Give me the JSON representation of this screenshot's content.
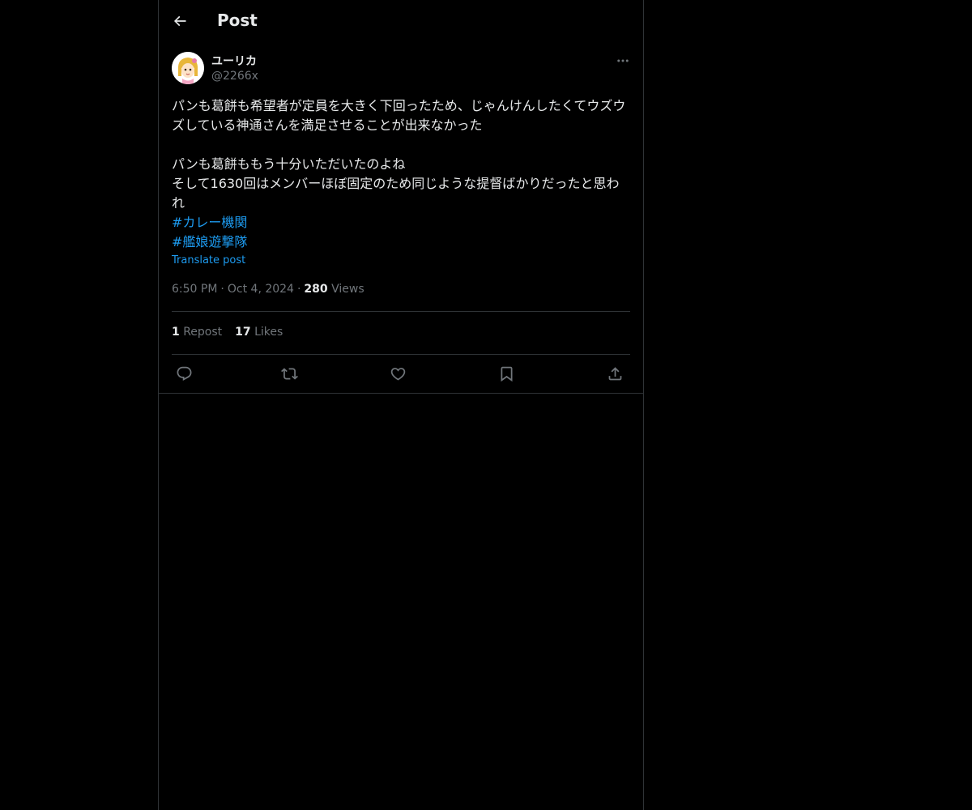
{
  "header": {
    "title": "Post"
  },
  "author": {
    "name": "ユーリカ",
    "handle": "@2266x"
  },
  "post": {
    "paragraph1": "パンも葛餅も希望者が定員を大きく下回ったため、じゃんけんしたくてウズウズしている神通さんを満足させることが出来なかった",
    "paragraph2_line1": "パンも葛餅ももう十分いただいたのよね",
    "paragraph2_line2": "そして1630回はメンバーほぼ固定のため同じような提督ばかりだったと思われ",
    "hashtags": [
      "#カレー機関",
      "#艦娘遊撃隊"
    ],
    "translate_label": "Translate post"
  },
  "meta": {
    "time": "6:50 PM",
    "date": "Oct 4, 2024",
    "views_count": "280",
    "views_label": "Views"
  },
  "stats": {
    "reposts_count": "1",
    "reposts_label": "Repost",
    "likes_count": "17",
    "likes_label": "Likes"
  },
  "icons": {
    "back": "arrow-left-icon",
    "more": "more-horizontal-icon",
    "reply": "reply-icon",
    "repost": "repost-icon",
    "like": "heart-icon",
    "bookmark": "bookmark-icon",
    "share": "share-icon"
  },
  "colors": {
    "background": "#000000",
    "text_primary": "#e7e9ea",
    "text_secondary": "#71767b",
    "accent": "#1d9bf0",
    "border": "#2f3336"
  }
}
